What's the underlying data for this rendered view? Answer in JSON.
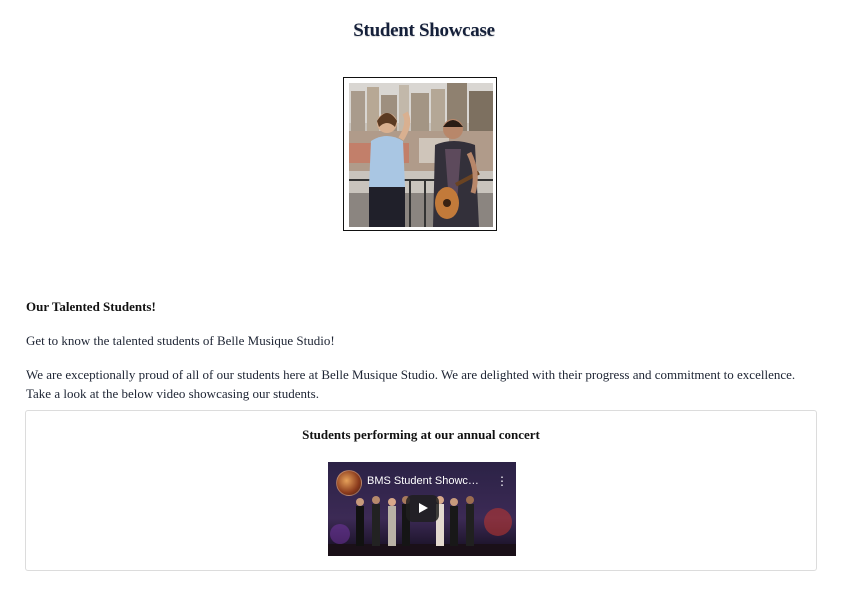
{
  "header": {
    "title": "Student Showcase"
  },
  "hero_image": {
    "icon": "student-duo-photo"
  },
  "content": {
    "heading": "Our Talented Students!",
    "intro": "Get to know the talented students of Belle Musique Studio!",
    "body": "We are exceptionally proud of all of our students here at Belle Musique Studio. We are delighted with their progress and commitment to excellence. Take a look at the below video showcasing our students."
  },
  "video": {
    "caption": "Students performing at our annual concert",
    "title": "BMS Student Showcase",
    "more_icon": "⋮",
    "play_icon": "play-icon"
  },
  "colors": {
    "text": "#1a2233",
    "card_border": "#dcdcdc",
    "background": "#ffffff"
  }
}
